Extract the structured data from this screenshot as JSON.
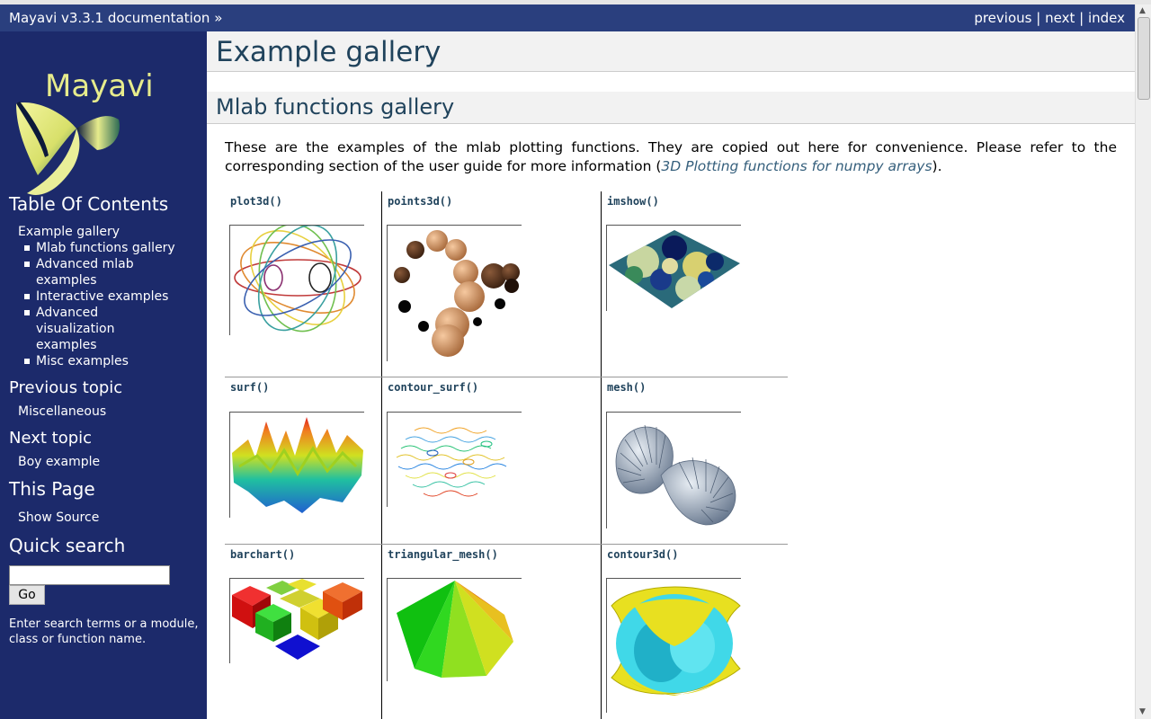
{
  "relbar": {
    "home": "Mayavi v3.3.1 documentation »",
    "previous": "previous",
    "next": "next",
    "index": "index",
    "sep": "|"
  },
  "sidebar": {
    "logo_text": "Mayavi",
    "toc_title": "Table Of Contents",
    "toc": [
      {
        "label": "Example gallery"
      },
      {
        "label": "Mlab functions gallery"
      },
      {
        "label": "Advanced mlab examples"
      },
      {
        "label": "Interactive examples"
      },
      {
        "label": "Advanced visualization examples"
      },
      {
        "label": "Misc examples"
      }
    ],
    "prev_title": "Previous topic",
    "prev_link": "Miscellaneous",
    "next_title": "Next topic",
    "next_link": "Boy example",
    "this_page_title": "This Page",
    "show_source": "Show Source",
    "search_title": "Quick search",
    "go": "Go",
    "hint": "Enter search terms or a module, class or function name."
  },
  "main": {
    "h1": "Example gallery",
    "h2": "Mlab functions gallery",
    "intro_text": "These are the examples of the mlab plotting functions. They are copied out here for convenience. Please refer to the corresponding section of the user guide for more information (",
    "intro_link": "3D Plotting functions for numpy arrays",
    "intro_end": ").",
    "gallery": [
      "plot3d()",
      "points3d()",
      "imshow()",
      "surf()",
      "contour_surf()",
      "mesh()",
      "barchart()",
      "triangular_mesh()",
      "contour3d()"
    ]
  },
  "colors": {
    "relbar": "#2a3f7e",
    "sidebar": "#1c2a6b",
    "heading": "#20435c"
  }
}
